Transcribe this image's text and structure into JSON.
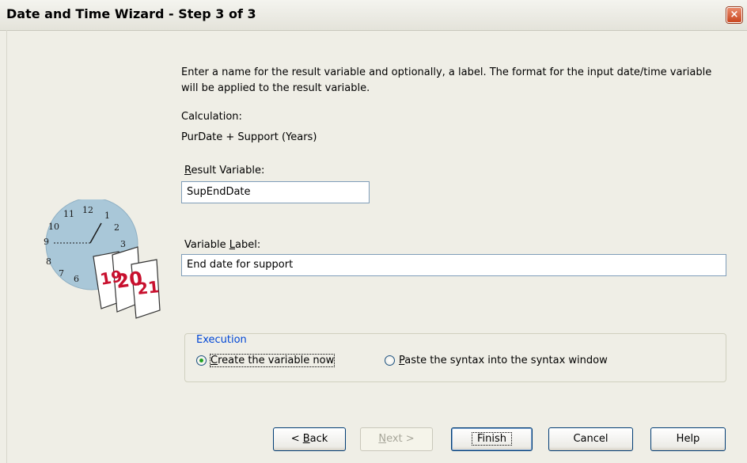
{
  "window": {
    "title": "Date and Time Wizard - Step 3 of 3",
    "close_label": "×"
  },
  "instructions": "Enter a name for the result variable and optionally, a label. The format for the input date/time variable will be applied to the result variable.",
  "calculation": {
    "label": "Calculation:",
    "value": "PurDate + Support (Years)"
  },
  "result_variable": {
    "label_prefix": "",
    "label_accel": "R",
    "label_rest": "esult Variable:",
    "value": "SupEndDate"
  },
  "variable_label": {
    "label_prefix": "Variable ",
    "label_accel": "L",
    "label_rest": "abel:",
    "value": "End date for support"
  },
  "execution": {
    "legend": "Execution",
    "options": [
      {
        "accel": "C",
        "rest": "reate the variable now",
        "selected": true
      },
      {
        "accel": "P",
        "rest": "aste the syntax into the syntax window",
        "selected": false
      }
    ]
  },
  "illustration": {
    "clock_numbers": [
      "12",
      "1",
      "2",
      "3",
      "11",
      "10",
      "9",
      "8",
      "7",
      "6"
    ],
    "calendar_pages": [
      "19",
      "20",
      "21"
    ]
  },
  "buttons": {
    "back_prefix": "< ",
    "back_accel": "B",
    "back_rest": "ack",
    "next_prefix": "",
    "next_accel": "N",
    "next_rest": "ext >",
    "finish": "Finish",
    "cancel": "Cancel",
    "help": "Help"
  },
  "colors": {
    "dialog_bg": "#efeee6",
    "legend_text": "#0046d5",
    "clock_face": "#a9c7d8"
  }
}
